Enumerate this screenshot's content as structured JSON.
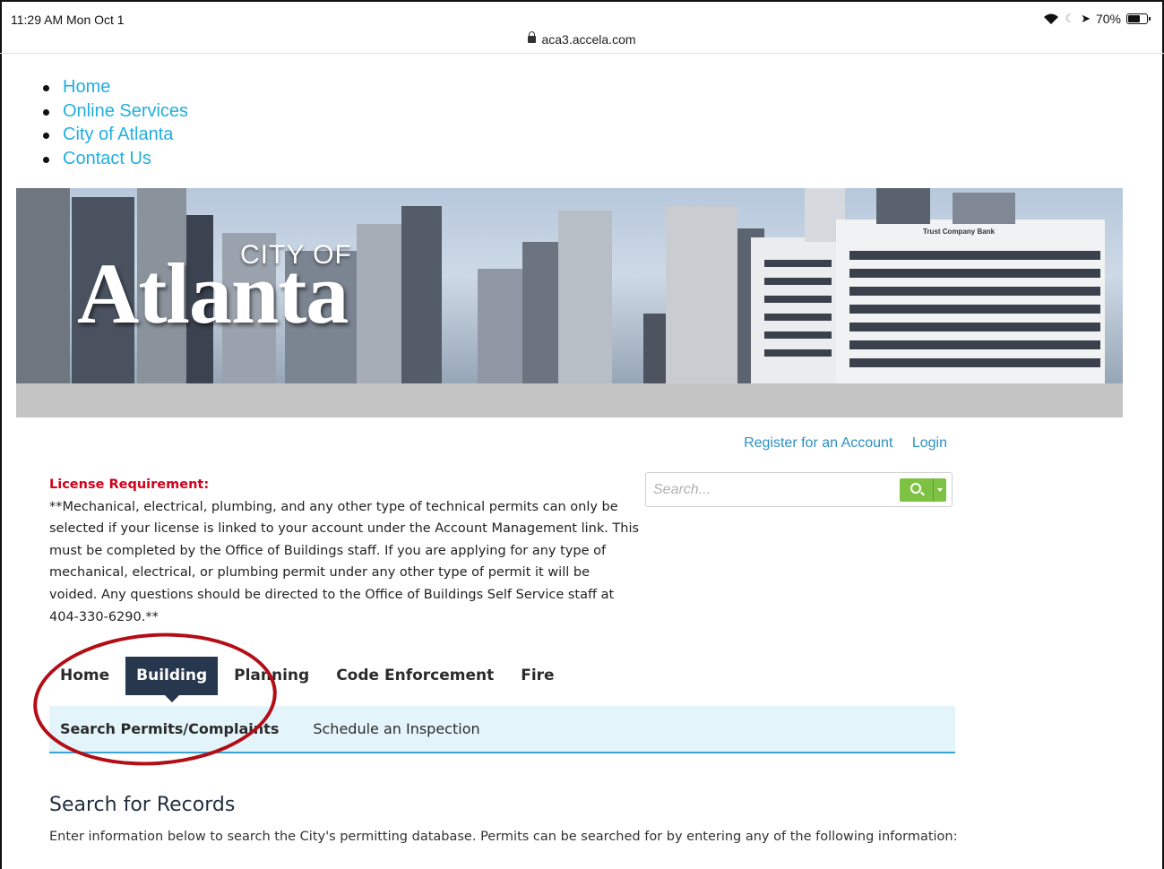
{
  "status_bar": {
    "time": "11:29 AM  Mon Oct 1",
    "url": "aca3.accela.com",
    "battery": "70%",
    "battery_level": 0.7
  },
  "top_nav": {
    "items": [
      "Home",
      "Online Services",
      "City of Atlanta",
      "Contact Us"
    ]
  },
  "banner": {
    "city_of": "CITY OF",
    "city_name": "Atlanta",
    "building_sign": "Trust Company Bank"
  },
  "account": {
    "register": "Register for an Account",
    "login": "Login"
  },
  "search": {
    "placeholder": "Search..."
  },
  "license": {
    "title": "License Requirement:",
    "body": "**Mechanical, electrical, plumbing, and any other type of technical permits can only be selected if your license is linked to your account under the Account Management link. This must be completed by the Office of Buildings staff. If you are applying for any type of mechanical, electrical, or plumbing permit under any other type of permit it will be voided.  Any questions should be directed to the Office of Buildings Self Service staff at 404-330-6290.**"
  },
  "tabs": [
    "Home",
    "Building",
    "Planning",
    "Code Enforcement",
    "Fire"
  ],
  "active_tab": "Building",
  "subnav": [
    "Search Permits/Complaints",
    "Schedule an Inspection"
  ],
  "records": {
    "title": "Search for Records",
    "description": "Enter information below to search the City's permitting database. Permits can be searched for by entering any of the following information:"
  },
  "colors": {
    "link": "#22aee0",
    "active_tab": "#27374d",
    "license_title": "#d0021b",
    "search_button": "#7dc242",
    "annotation": "#b30d16"
  }
}
